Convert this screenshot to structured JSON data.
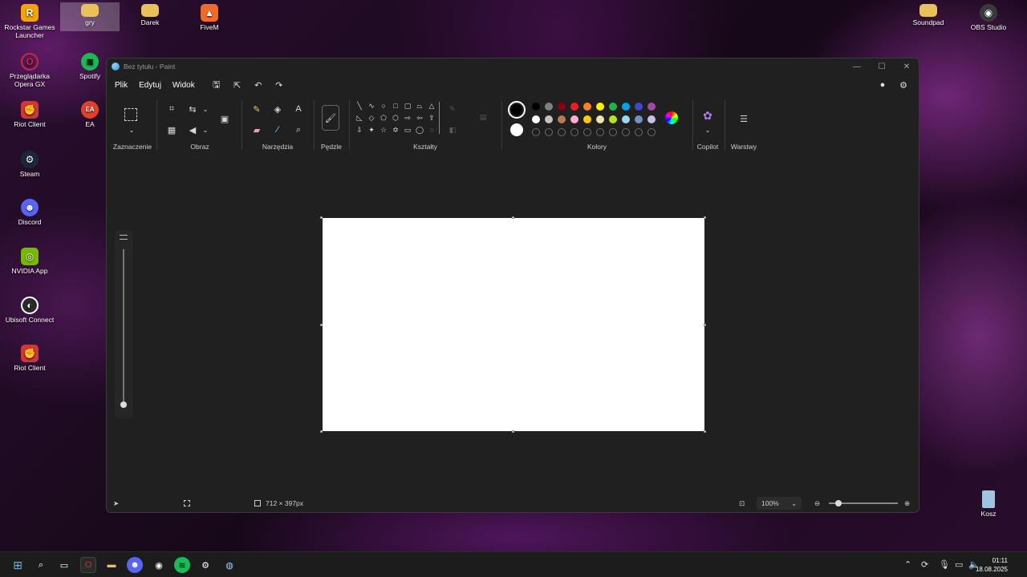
{
  "desktop": {
    "icons": [
      {
        "label": "Rockstar Games Launcher",
        "icon": "rockstar-icon",
        "color": "#f5a300"
      },
      {
        "label": "gry",
        "icon": "folder-icon",
        "color": "#e8c15a"
      },
      {
        "label": "Darek",
        "icon": "folder-icon",
        "color": "#e8c15a"
      },
      {
        "label": "FiveM",
        "icon": "fivem-icon",
        "color": "#f26a2a"
      },
      {
        "label": "Soundpad",
        "icon": "folder-icon",
        "color": "#e8c15a"
      },
      {
        "label": "OBS Studio",
        "icon": "obs-icon",
        "color": "#3a3a3a"
      },
      {
        "label": "Przeglądarka Opera GX",
        "icon": "opera-gx-icon",
        "color": "#d0283c"
      },
      {
        "label": "Spotify",
        "icon": "spotify-icon",
        "color": "#1db954"
      },
      {
        "label": "Riot Client",
        "icon": "riot-icon",
        "color": "#d13639"
      },
      {
        "label": "EA",
        "icon": "ea-icon",
        "color": "#e2402a"
      },
      {
        "label": "Steam",
        "icon": "steam-icon",
        "color": "#1b2838"
      },
      {
        "label": "Discord",
        "icon": "discord-icon",
        "color": "#5865f2"
      },
      {
        "label": "NVIDIA App",
        "icon": "nvidia-icon",
        "color": "#76b900"
      },
      {
        "label": "Ubisoft Connect",
        "icon": "ubisoft-icon",
        "color": "#2a2a2a"
      },
      {
        "label": "Riot Client",
        "icon": "riot-icon",
        "color": "#d13639"
      },
      {
        "label": "Kosz",
        "icon": "recycle-bin-icon",
        "color": "#9fc3e0"
      }
    ]
  },
  "paint": {
    "title": "Bez tytułu - Paint",
    "menu": [
      "Plik",
      "Edytuj",
      "Widok"
    ],
    "groups": {
      "selection": "Zaznaczenie",
      "image": "Obraz",
      "tools": "Narzędzia",
      "brushes": "Pędzle",
      "shapes": "Kształty",
      "colors": "Kolory",
      "copilot": "Copilot",
      "layers": "Warstwy"
    },
    "colors": {
      "primary": "#000000",
      "secondary": "#ffffff",
      "row1": [
        "#000000",
        "#7f7f7f",
        "#880015",
        "#ed1c24",
        "#ff7f27",
        "#fff200",
        "#22b14c",
        "#00a2e8",
        "#3f48cc",
        "#a349a4"
      ],
      "row2": [
        "#ffffff",
        "#c3c3c3",
        "#b97a57",
        "#ffaec9",
        "#ffc90e",
        "#efe4b0",
        "#b5e61d",
        "#99d9ea",
        "#7092be",
        "#c8bfe7"
      ]
    },
    "status": {
      "canvas_size": "712 × 397px",
      "zoom": "100%"
    }
  },
  "taskbar": {
    "time": "01:11",
    "date": "18.08.2025"
  }
}
